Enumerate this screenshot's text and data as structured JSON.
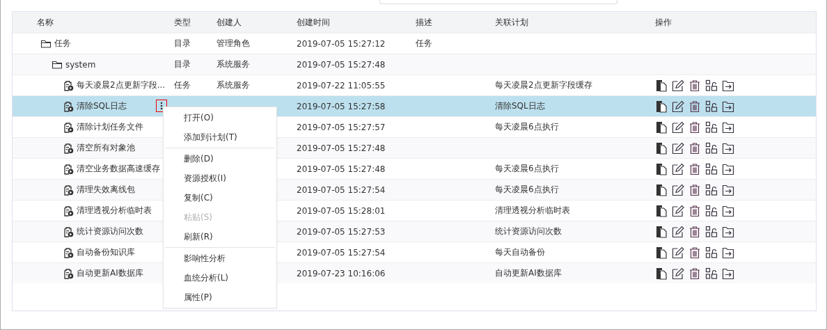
{
  "table": {
    "columns": [
      "名称",
      "类型",
      "创建人",
      "创建时间",
      "描述",
      "关联计划",
      "操作"
    ],
    "rows": [
      {
        "kind": "folder",
        "name": "任务",
        "type": "目录",
        "creator": "管理角色",
        "created": "2019-07-05 15:27:12",
        "description": "任务",
        "selected": false,
        "children": [
          {
            "kind": "folder",
            "name": "system",
            "type": "目录",
            "creator": "系统服务",
            "created": "2019-07-05 15:27:48",
            "selected": false,
            "children": [
              {
                "kind": "task",
                "name": "每天凌晨2点更新字段...",
                "type": "任务",
                "creator": "系统服务",
                "created": "2019-07-22 11:05:55",
                "plan": "每天凌晨2点更新字段缓存",
                "selected": false
              },
              {
                "kind": "task",
                "name": "清除SQL日志",
                "created": "2019-07-05 15:27:58",
                "plan": "清除SQL日志",
                "selected": true
              },
              {
                "kind": "task",
                "name": "清除计划任务文件",
                "created": "2019-07-05 15:27:57",
                "plan": "每天凌晨6点执行",
                "selected": false
              },
              {
                "kind": "task",
                "name": "清空所有对象池",
                "created": "2019-07-05 15:27:48",
                "selected": false
              },
              {
                "kind": "task",
                "name": "清空业务数据高速缓存",
                "created": "2019-07-05 15:27:48",
                "plan": "每天凌晨6点执行",
                "selected": false
              },
              {
                "kind": "task",
                "name": "清理失效离线包",
                "created": "2019-07-05 15:27:54",
                "plan": "每天凌晨6点执行",
                "selected": false
              },
              {
                "kind": "task",
                "name": "清理透视分析临时表",
                "created": "2019-07-05 15:28:01",
                "plan": "清理透视分析临时表",
                "selected": false
              },
              {
                "kind": "task",
                "name": "统计资源访问次数",
                "created": "2019-07-05 15:27:53",
                "plan": "统计资源访问次数",
                "selected": false
              },
              {
                "kind": "task",
                "name": "自动备份知识库",
                "created": "2019-07-05 15:27:54",
                "plan": "每天自动备份",
                "selected": false
              },
              {
                "kind": "task",
                "name": "自动更新AI数据库",
                "created": "2019-07-23 10:16:06",
                "plan": "自动更新AI数据库",
                "selected": false
              }
            ]
          }
        ]
      }
    ]
  },
  "context_menu": {
    "groups": [
      [
        {
          "label": "打开(O)",
          "disabled": false
        },
        {
          "label": "添加到计划(T)",
          "disabled": false
        }
      ],
      [
        {
          "label": "删除(D)",
          "disabled": false
        },
        {
          "label": "资源授权(I)",
          "disabled": false
        },
        {
          "label": "复制(C)",
          "disabled": false
        },
        {
          "label": "粘贴(S)",
          "disabled": true
        },
        {
          "label": "刷新(R)",
          "disabled": false
        }
      ],
      [
        {
          "label": "影响性分析",
          "disabled": false
        },
        {
          "label": "血统分析(L)",
          "disabled": false
        },
        {
          "label": "属性(P)",
          "disabled": false
        }
      ]
    ]
  }
}
